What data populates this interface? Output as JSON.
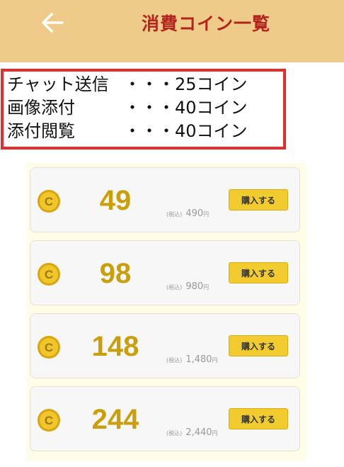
{
  "header": {
    "title": "消費コイン一覧",
    "bg_color": "#eecb89",
    "title_color": "#b3261e",
    "back_icon": "arrow-left-icon"
  },
  "costs": [
    {
      "label": "チャット送信",
      "value": "・・・25コイン"
    },
    {
      "label": "画像添付",
      "value": "・・・40コイン"
    },
    {
      "label": "添付閲覧",
      "value": "・・・40コイン"
    }
  ],
  "packages": [
    {
      "coins": "49",
      "tax_label": "(税込)",
      "price": "490",
      "yen": "円",
      "button": "購入する"
    },
    {
      "coins": "98",
      "tax_label": "(税込)",
      "price": "980",
      "yen": "円",
      "button": "購入する"
    },
    {
      "coins": "148",
      "tax_label": "(税込)",
      "price": "1,480",
      "yen": "円",
      "button": "購入する"
    },
    {
      "coins": "244",
      "tax_label": "(税込)",
      "price": "2,440",
      "yen": "円",
      "button": "購入する"
    }
  ],
  "coin_icon_letter": "C",
  "colors": {
    "accent_gold": "#c9a00c",
    "buy_button": "#f2cc2f",
    "highlight_border": "#e52b2b"
  }
}
